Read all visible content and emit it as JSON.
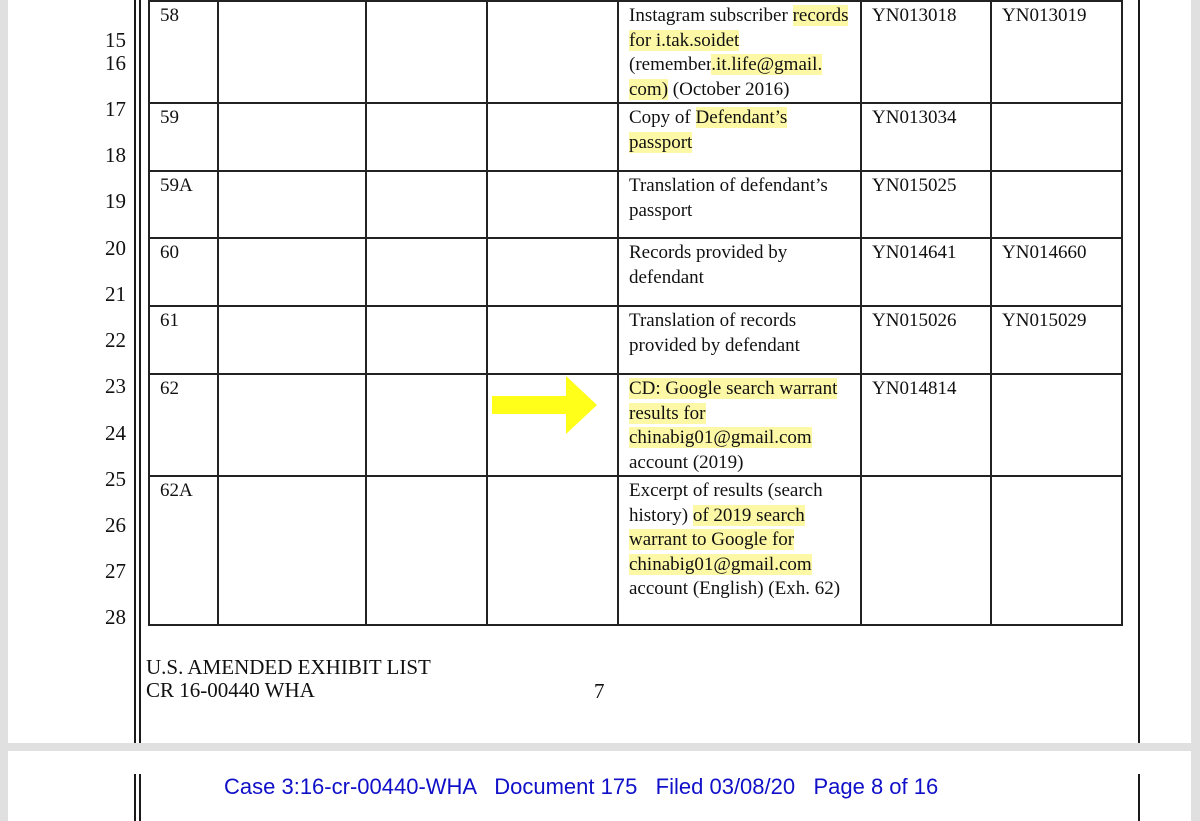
{
  "line_numbers": [
    "15",
    "16",
    "17",
    "18",
    "19",
    "20",
    "21",
    "22",
    "23",
    "24",
    "25",
    "26",
    "27",
    "28"
  ],
  "table": {
    "rows": [
      {
        "exhibit_no": "58",
        "description": [
          {
            "text": "Instagram subscriber ",
            "hl": false
          },
          {
            "text": "records for i.tak.soidet",
            "hl": true
          },
          {
            "text": " (remember",
            "hl": false
          },
          {
            "text": ".it.life@gmail. com)",
            "hl": true
          },
          {
            "text": " (October 2016)",
            "hl": false
          }
        ],
        "bates_begin": "YN013018",
        "bates_end": "YN013019"
      },
      {
        "exhibit_no": "59",
        "description": [
          {
            "text": "Copy of ",
            "hl": false
          },
          {
            "text": "Defendant’s passport",
            "hl": true
          }
        ],
        "bates_begin": "YN013034",
        "bates_end": ""
      },
      {
        "exhibit_no": "59A",
        "description": [
          {
            "text": "Translation of defendant’s passport",
            "hl": false
          }
        ],
        "bates_begin": "YN015025",
        "bates_end": ""
      },
      {
        "exhibit_no": "60",
        "description": [
          {
            "text": "Records provided by defendant",
            "hl": false
          }
        ],
        "bates_begin": "YN014641",
        "bates_end": "YN014660"
      },
      {
        "exhibit_no": "61",
        "description": [
          {
            "text": "Translation of records provided by defendant",
            "hl": false
          }
        ],
        "bates_begin": "YN015026",
        "bates_end": "YN015029"
      },
      {
        "exhibit_no": "62",
        "description": [
          {
            "text": "CD: Google search warrant results for chinabig01@gmail.com",
            "hl": true
          },
          {
            "text": " account (2019)",
            "hl": false
          }
        ],
        "bates_begin": "YN014814",
        "bates_end": "",
        "annotation": "yellow-arrow"
      },
      {
        "exhibit_no": "62A",
        "description": [
          {
            "text": "Excerpt of results (search history) ",
            "hl": false
          },
          {
            "text": "of 2019 search warrant to Google for chinabig01@gmail.com",
            "hl": true
          },
          {
            "text": " account (English) (Exh. 62)",
            "hl": false
          }
        ],
        "bates_begin": "",
        "bates_end": ""
      }
    ]
  },
  "footer": {
    "title_line1": "U.S. AMENDED EXHIBIT LIST",
    "title_line2": "CR 16-00440 WHA",
    "page_number": "7"
  },
  "next_page_header": {
    "case": "Case 3:16-cr-00440-WHA",
    "document": "Document 175",
    "filed": "Filed 03/08/20",
    "page": "Page 8 of 16",
    "color": "#1010c8"
  },
  "colors": {
    "highlight": "#fdf8a6",
    "arrow": "#ffff1a"
  }
}
